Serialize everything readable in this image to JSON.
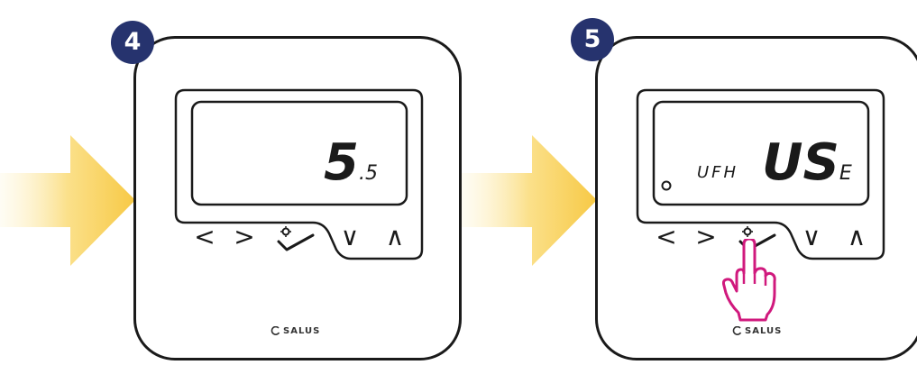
{
  "steps": [
    {
      "number": "4",
      "display": {
        "value_big": "5",
        "value_small": ".5"
      },
      "buttons": {
        "prev": "<",
        "next": ">",
        "down": "∨",
        "up": "∧"
      },
      "brand": "SALUS"
    },
    {
      "number": "5",
      "display": {
        "label": "UFH",
        "value_big": "US",
        "value_small": "E"
      },
      "buttons": {
        "prev": "<",
        "next": ">",
        "down": "∨",
        "up": "∧"
      },
      "brand": "SALUS"
    }
  ],
  "colors": {
    "badge": "#26336e",
    "arrow": "#f7c945",
    "hand": "#d0197d",
    "outline": "#1a1a1a"
  }
}
